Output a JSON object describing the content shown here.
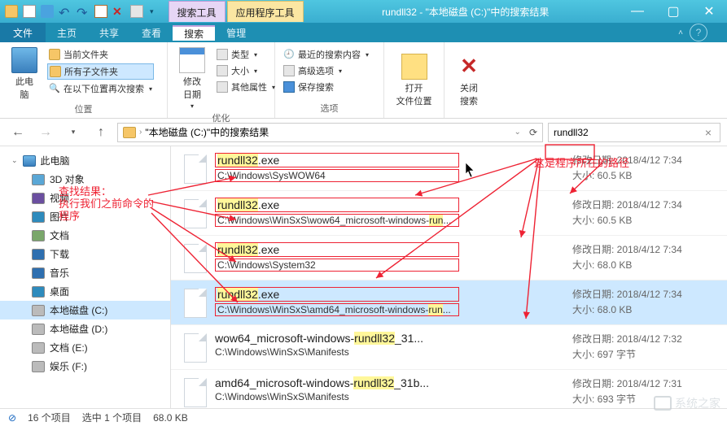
{
  "quick_access_icons": [
    "new-doc",
    "save",
    "undo",
    "redo",
    "mail",
    "delete",
    "close-many"
  ],
  "context_tabs": {
    "search_tools": "搜索工具",
    "app_tools": "应用程序工具"
  },
  "window_title": "rundll32 - \"本地磁盘 (C:)\"中的搜索结果",
  "win_btns": [
    "min",
    "max",
    "close"
  ],
  "menu": {
    "file": "文件",
    "items": [
      "主页",
      "共享",
      "查看",
      "搜索",
      "管理"
    ],
    "active": "搜索"
  },
  "ribbon": {
    "group_location": {
      "label": "位置",
      "this_pc": "此电\n脑",
      "current_folder": "当前文件夹",
      "all_subfolders": "所有子文件夹",
      "search_again": "在以下位置再次搜索"
    },
    "group_optimize": {
      "label": "优化",
      "modify_date": "修改\n日期",
      "type": "类型",
      "size": "大小",
      "other_attr": "其他属性"
    },
    "group_options": {
      "label": "选项",
      "recent": "最近的搜索内容",
      "advanced": "高级选项",
      "save_search": "保存搜索"
    },
    "open_location": "打开\n文件位置",
    "close_search": "关闭\n搜索"
  },
  "addr": {
    "path": "\"本地磁盘 (C:)\"中的搜索结果",
    "refresh": "⟳",
    "search_value": "rundll32"
  },
  "nav": {
    "this_pc": "此电脑",
    "items": [
      {
        "label": "3D 对象",
        "icon": "cube"
      },
      {
        "label": "视频",
        "icon": "video"
      },
      {
        "label": "图片",
        "icon": "picture"
      },
      {
        "label": "文档",
        "icon": "doc"
      },
      {
        "label": "下载",
        "icon": "download"
      },
      {
        "label": "音乐",
        "icon": "music"
      },
      {
        "label": "桌面",
        "icon": "desktop"
      },
      {
        "label": "本地磁盘 (C:)",
        "icon": "hdd",
        "sel": true
      },
      {
        "label": "本地磁盘 (D:)",
        "icon": "hdd"
      },
      {
        "label": "文档 (E:)",
        "icon": "hdd"
      },
      {
        "label": "娱乐 (F:)",
        "icon": "hdd"
      }
    ]
  },
  "results": [
    {
      "name": "rundll32.exe",
      "path": "C:\\Windows\\SysWOW64",
      "date": "2018/4/12 7:34",
      "size": "60.5 KB",
      "hl": "rundll32",
      "sel": false,
      "boxed": true
    },
    {
      "name": "rundll32.exe",
      "path": "C:\\Windows\\WinSxS\\wow64_microsoft-windows-run...",
      "date": "2018/4/12 7:34",
      "size": "60.5 KB",
      "hl": "rundll32",
      "sel": false,
      "boxed": true,
      "path_hl": "run"
    },
    {
      "name": "rundll32.exe",
      "path": "C:\\Windows\\System32",
      "date": "2018/4/12 7:34",
      "size": "68.0 KB",
      "hl": "rundll32",
      "sel": false,
      "boxed": true
    },
    {
      "name": "rundll32.exe",
      "path": "C:\\Windows\\WinSxS\\amd64_microsoft-windows-run...",
      "date": "2018/4/12 7:34",
      "size": "68.0 KB",
      "hl": "rundll32",
      "sel": true,
      "boxed": true,
      "path_hl": "run"
    },
    {
      "name": "wow64_microsoft-windows-rundll32_31...",
      "path": "C:\\Windows\\WinSxS\\Manifests",
      "date": "2018/4/12 7:32",
      "size": "697 字节",
      "hl": "rundll32",
      "sel": false
    },
    {
      "name": "amd64_microsoft-windows-rundll32_31b...",
      "path": "C:\\Windows\\WinSxS\\Manifests",
      "date": "2018/4/12 7:31",
      "size": "693 字节",
      "hl": "rundll32",
      "sel": false
    }
  ],
  "result_meta_labels": {
    "date": "修改日期:",
    "size": "大小:"
  },
  "status": {
    "count": "16 个项目",
    "selected": "选中 1 个项目",
    "selsize": "68.0 KB"
  },
  "annotations": {
    "path_note": "这是程序所在的路径",
    "result_note_l1": "查找结果：",
    "result_note_l2": "执行我们之前命令的",
    "result_note_l3": "程序"
  },
  "watermark": "系统之家"
}
